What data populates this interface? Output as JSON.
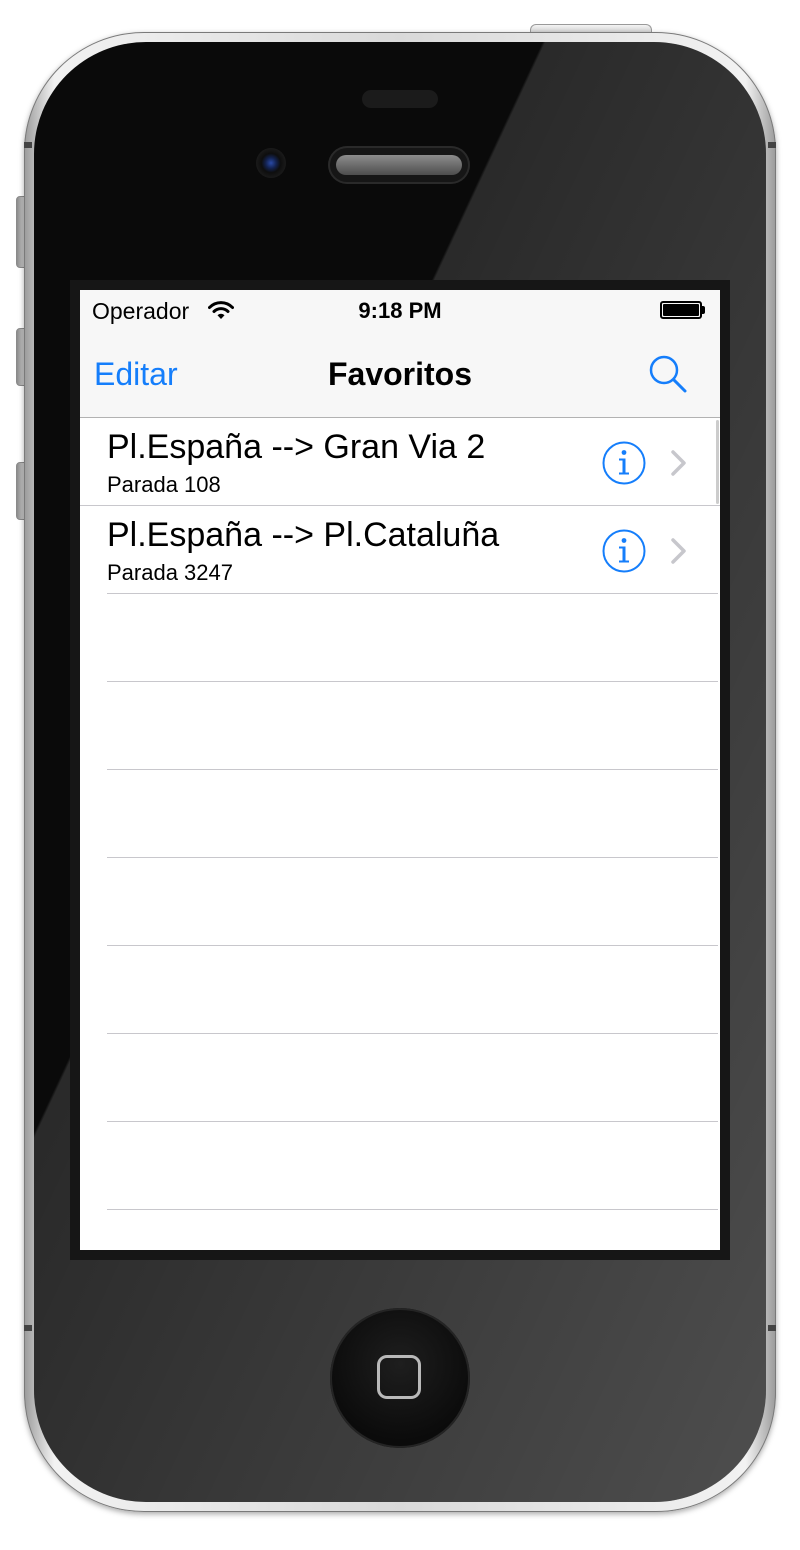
{
  "status_bar": {
    "carrier": "Operador",
    "time": "9:18 PM",
    "wifi_icon": "wifi-icon",
    "battery_icon": "battery-full-icon"
  },
  "nav_bar": {
    "left_button": "Editar",
    "title": "Favoritos",
    "right_icon": "search-icon"
  },
  "favorites": [
    {
      "title": "Pl.España --> Gran Via 2",
      "subtitle": "Parada 108",
      "info_icon": "info-icon",
      "accessory_icon": "chevron-right-icon"
    },
    {
      "title": "Pl.España --> Pl.Cataluña",
      "subtitle": "Parada 3247",
      "info_icon": "info-icon",
      "accessory_icon": "chevron-right-icon"
    }
  ],
  "colors": {
    "tint": "#157efb",
    "bar_background": "#f7f7f7",
    "separator": "#c8c7cc"
  }
}
